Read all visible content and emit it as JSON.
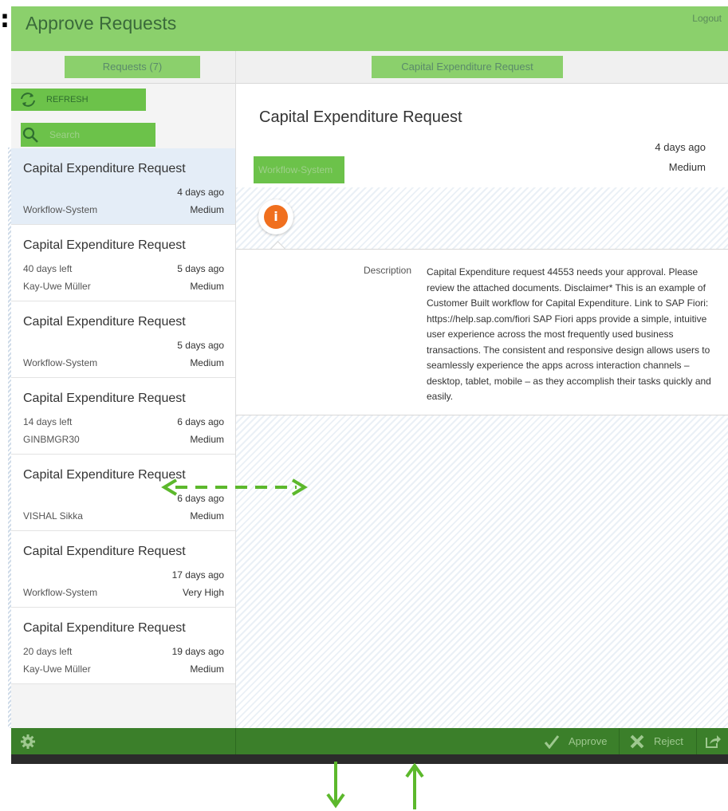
{
  "header": {
    "colon": ":",
    "title": "Approve Requests",
    "logout_label": "Logout"
  },
  "master": {
    "header_label": "Requests (7)",
    "refresh_label": "REFRESH",
    "search_placeholder": "Search",
    "items": [
      {
        "title": "Capital Expenditure Request",
        "due": "",
        "age": "4 days ago",
        "creator": "Workflow-System",
        "priority": "Medium"
      },
      {
        "title": "Capital Expenditure Request",
        "due": "40 days left",
        "age": "5 days ago",
        "creator": "Kay-Uwe Müller",
        "priority": "Medium"
      },
      {
        "title": "Capital Expenditure Request",
        "due": "",
        "age": "5 days ago",
        "creator": "Workflow-System",
        "priority": "Medium"
      },
      {
        "title": "Capital Expenditure Request",
        "due": "14 days left",
        "age": "6 days ago",
        "creator": "GINBMGR30",
        "priority": "Medium"
      },
      {
        "title": "Capital Expenditure Request",
        "due": "",
        "age": "6 days ago",
        "creator": "VISHAL Sikka",
        "priority": "Medium"
      },
      {
        "title": "Capital Expenditure Request",
        "due": "",
        "age": "17 days ago",
        "creator": "Workflow-System",
        "priority": "Very High"
      },
      {
        "title": "Capital Expenditure Request",
        "due": "20 days left",
        "age": "19 days ago",
        "creator": "Kay-Uwe Müller",
        "priority": "Medium"
      }
    ]
  },
  "detail": {
    "header_label": "Capital Expenditure Request",
    "title": "Capital Expenditure Request",
    "age": "4 days ago",
    "priority": "Medium",
    "creator": "Workflow-System",
    "info_tab_glyph": "i",
    "description_label": "Description",
    "description": "Capital Expenditure request 44553 needs your approval. Please review the attached documents. Disclaimer* This is an example of Customer Built workflow for Capital Expenditure. Link to SAP Fiori: https://help.sap.com/fiori SAP Fiori apps provide a simple, intuitive user experience across the most frequently used business transactions. The consistent and responsive design allows users to seamlessly experience the apps across interaction channels – desktop, tablet, mobile – as they accomplish their tasks quickly and easily."
  },
  "footer": {
    "approve_label": "Approve",
    "reject_label": "Reject"
  },
  "colors": {
    "highlight_green": "#8bd06c",
    "footer_green": "#3b7f2a",
    "info_orange": "#f06f1e",
    "selected_item": "#e4edf7",
    "annotation_arrow": "#5cb82c"
  },
  "icons": [
    "refresh-icon",
    "search-icon",
    "info-icon",
    "gear-icon",
    "check-icon",
    "reject-icon",
    "share-icon"
  ]
}
